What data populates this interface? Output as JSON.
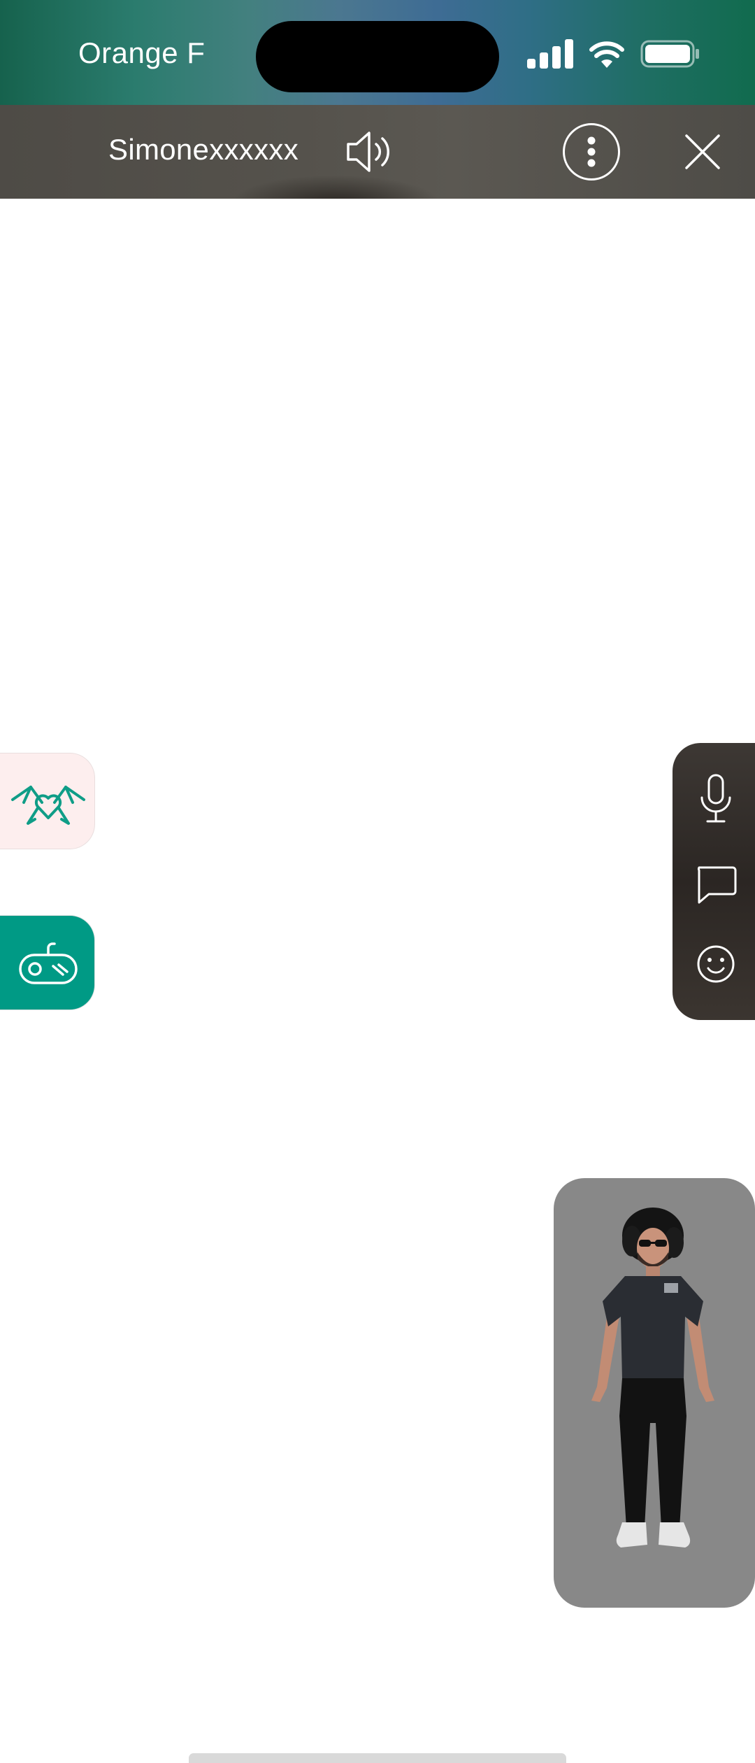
{
  "status_bar": {
    "carrier": "Orange F",
    "icons": [
      "cellular-signal-icon",
      "wifi-icon",
      "battery-icon"
    ]
  },
  "header": {
    "user_name": "Simonexxxxxx",
    "icons": [
      "speaker-icon",
      "more-options-icon",
      "close-icon"
    ]
  },
  "left_actions": [
    {
      "name": "wings-heart-button",
      "icon": "wings-heart-icon",
      "background": "#fdeeee",
      "icon_color": "#0f9d87"
    },
    {
      "name": "game-controller-button",
      "icon": "game-controller-icon",
      "background": "#009a85",
      "icon_color": "#ffffff"
    }
  ],
  "right_actions": [
    {
      "name": "microphone-button",
      "icon": "microphone-icon"
    },
    {
      "name": "chat-button",
      "icon": "chat-bubble-icon"
    },
    {
      "name": "emoji-button",
      "icon": "smiley-icon"
    }
  ],
  "avatar_preview": {
    "background": "#888888"
  },
  "colors": {
    "accent": "#009a85",
    "accent_light": "#fdeeee",
    "header_bg": "#53504b",
    "panel_bg": "#2f2a27"
  }
}
